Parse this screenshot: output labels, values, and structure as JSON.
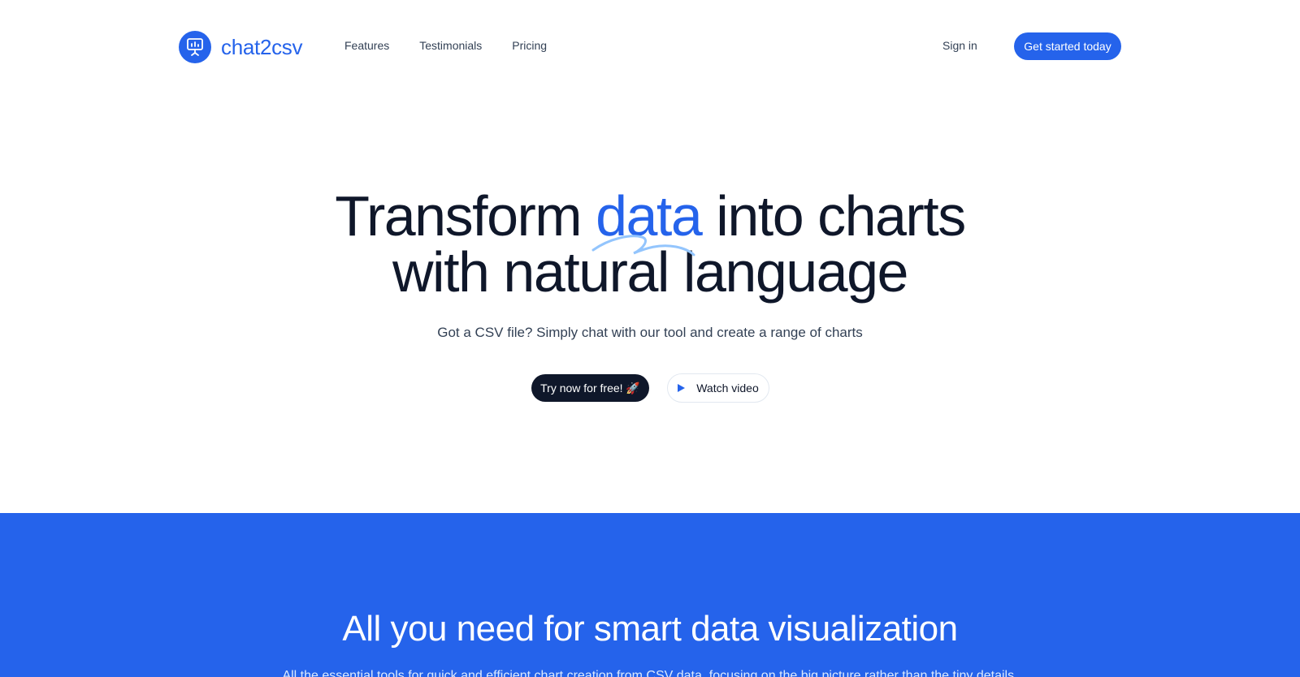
{
  "brand": {
    "name": "chat2csv",
    "icon": "presentation-chart-icon",
    "color": "#2563eb"
  },
  "nav": {
    "items": [
      {
        "label": "Features"
      },
      {
        "label": "Testimonials"
      },
      {
        "label": "Pricing"
      }
    ],
    "signin_label": "Sign in",
    "cta_label": "Get started today"
  },
  "hero": {
    "title_before": "Transform ",
    "title_accent": "data",
    "title_after": " into charts",
    "title_line2": "with natural language",
    "subtitle": "Got a CSV file? Simply chat with our tool and create a range of charts",
    "try_label": "Try now for free! 🚀",
    "watch_label": "Watch video",
    "watch_icon": "play-icon"
  },
  "features": {
    "title": "All you need for smart data visualization",
    "subtitle": "All the essential tools for quick and efficient chart creation from CSV data, focusing on the big picture rather than the tiny details.",
    "background": "#2563eb"
  },
  "colors": {
    "text_dark": "#0f172a",
    "text_muted": "#334155",
    "accent": "#2563eb"
  }
}
